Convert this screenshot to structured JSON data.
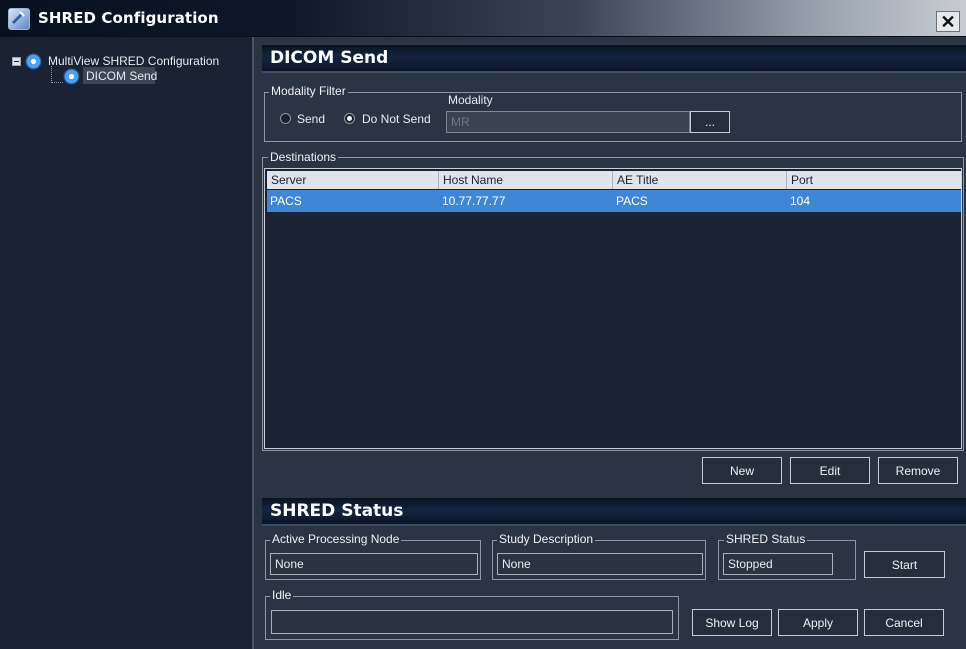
{
  "window": {
    "title": "SHRED Configuration",
    "close_glyph": "✕"
  },
  "tree": {
    "root": {
      "label": "MultiView SHRED Configuration",
      "icon": "gear-icon"
    },
    "child": {
      "label": "DICOM Send",
      "icon": "gear-icon"
    }
  },
  "dicom_send": {
    "header": "DICOM Send",
    "modality_filter": {
      "title": "Modality Filter",
      "send_label": "Send",
      "do_not_send_label": "Do Not Send",
      "selected": "Do Not Send",
      "modality_label": "Modality",
      "modality_value": "MR",
      "browse_label": "..."
    },
    "destinations": {
      "title": "Destinations",
      "columns": [
        "Server",
        "Host Name",
        "AE Title",
        "Port"
      ],
      "rows": [
        {
          "server": "PACS",
          "host": "10.77.77.77",
          "ae_title": "PACS",
          "port": "104"
        }
      ]
    },
    "buttons": {
      "new": "New",
      "edit": "Edit",
      "remove": "Remove"
    }
  },
  "shred_status": {
    "header": "SHRED Status",
    "active_node": {
      "title": "Active Processing Node",
      "value": "None"
    },
    "study_description": {
      "title": "Study Description",
      "value": "None"
    },
    "status": {
      "title": "SHRED Status",
      "value": "Stopped"
    },
    "idle": {
      "title": "Idle",
      "value": ""
    },
    "buttons": {
      "start": "Start",
      "show_log": "Show Log",
      "apply": "Apply",
      "cancel": "Cancel"
    }
  },
  "colors": {
    "selection": "#3f86d6",
    "background": "#2b3443",
    "panel": "#1b2333"
  }
}
